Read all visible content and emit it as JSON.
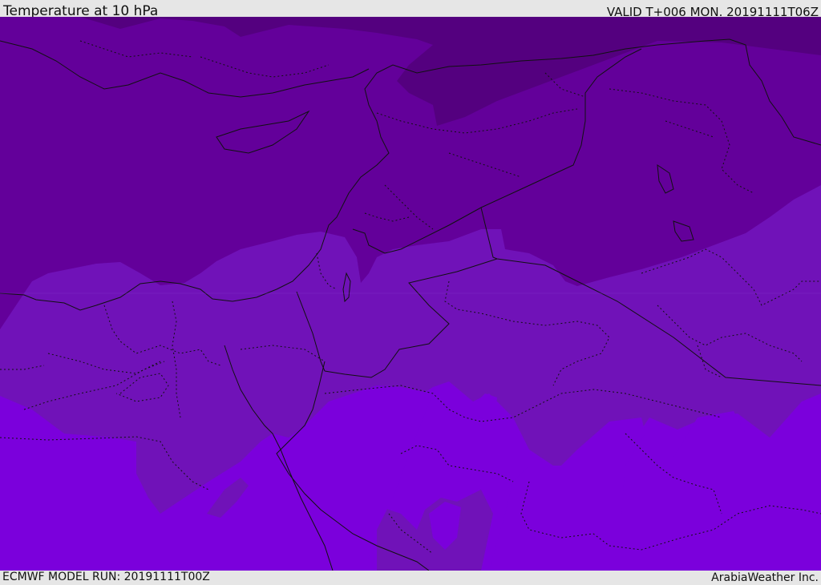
{
  "header": {
    "title": "Temperature at 10 hPa",
    "valid": "VALID T+006 MON. 20191111T06Z"
  },
  "footer": {
    "model_run": "ECMWF MODEL RUN: 20191111T00Z",
    "credit": "ArabiaWeather Inc."
  },
  "map": {
    "colors": {
      "darkest_band": "#54007f",
      "dark_band": "#63009a",
      "mid_band": "#7012b8",
      "light_band": "#7b00dc",
      "coastline": "#111111",
      "border": "#111111"
    }
  }
}
